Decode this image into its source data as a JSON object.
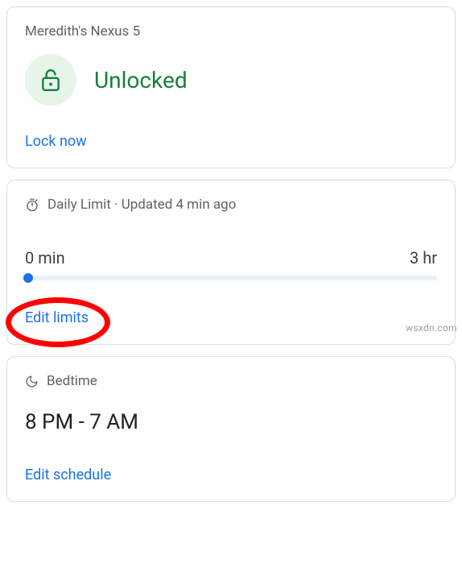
{
  "device_card": {
    "title": "Meredith's Nexus 5",
    "status": "Unlocked",
    "action": "Lock now"
  },
  "daily_limit_card": {
    "label": "Daily Limit",
    "updated": "Updated 4 min ago",
    "min_label": "0 min",
    "max_label": "3 hr",
    "action": "Edit limits"
  },
  "bedtime_card": {
    "label": "Bedtime",
    "range": "8 PM - 7 AM",
    "action": "Edit schedule"
  },
  "watermark": "wsxdn.com",
  "colors": {
    "green": "#188038",
    "blue": "#1a73e8",
    "gray": "#5f6368",
    "highlight": "#ff0000"
  }
}
